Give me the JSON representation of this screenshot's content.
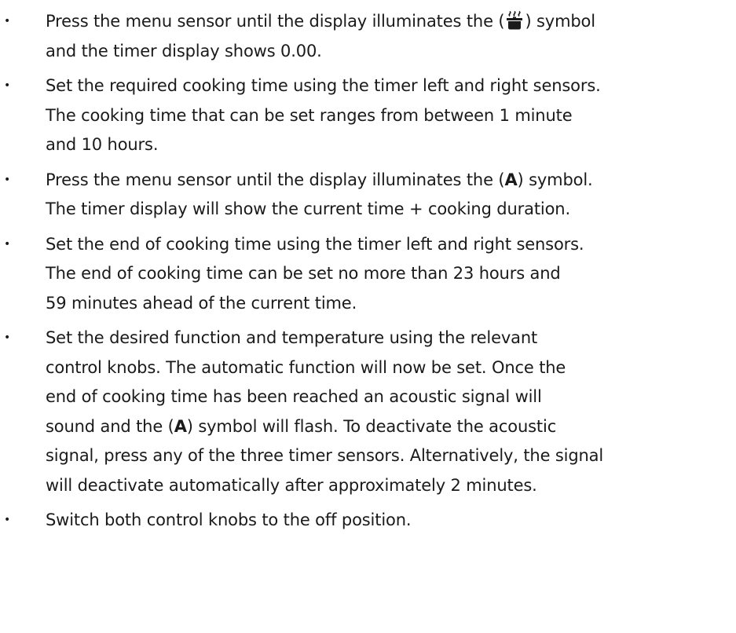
{
  "instructions": [
    {
      "lines": [
        {
          "before": "Press the menu sensor until the display illuminates the (",
          "icon": "steam-pot-icon",
          "after": ") symbol"
        },
        {
          "text": "and the timer display shows 0.00."
        }
      ]
    },
    {
      "lines": [
        {
          "text": "Set the required cooking time using the timer left and right sensors."
        },
        {
          "text": "The cooking time that can be set ranges from between 1 minute"
        },
        {
          "text": "and 10 hours."
        }
      ]
    },
    {
      "lines": [
        {
          "before": "Press the menu sensor until the display illuminates the (",
          "bold": "A",
          "after": ") symbol."
        },
        {
          "text": "The timer display will show the current time + cooking duration."
        }
      ]
    },
    {
      "lines": [
        {
          "text": "Set the end of cooking time using the timer left and right sensors."
        },
        {
          "text": "The end of cooking time can be set no more than 23 hours and"
        },
        {
          "text": "59 minutes ahead of the current time."
        }
      ]
    },
    {
      "lines": [
        {
          "text": "Set the desired function and temperature using the relevant"
        },
        {
          "text": "control knobs. The automatic function will now be set. Once the"
        },
        {
          "text": "end of cooking time has been reached an acoustic signal will"
        },
        {
          "before": "sound and the (",
          "bold": "A",
          "after": ") symbol will flash. To deactivate the acoustic"
        },
        {
          "text": "signal, press any of the three timer sensors. Alternatively, the signal"
        },
        {
          "text": "will deactivate automatically after approximately 2 minutes."
        }
      ]
    },
    {
      "lines": [
        {
          "text": "Switch both control knobs to the off position."
        }
      ]
    }
  ],
  "bullet_symbol": "•"
}
